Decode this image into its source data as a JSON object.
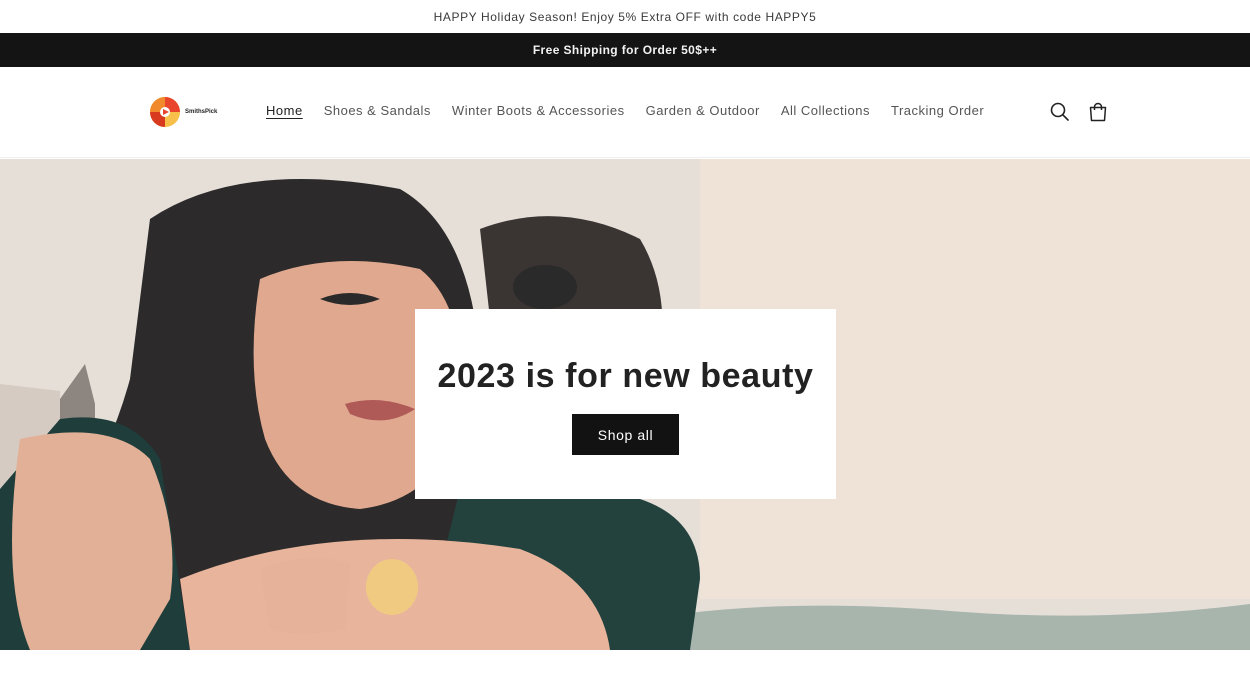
{
  "announcement": {
    "text": "HAPPY Holiday Season! Enjoy 5% Extra OFF with code HAPPY5"
  },
  "shipping_bar": {
    "text": "Free Shipping for Order 50$++"
  },
  "header": {
    "logo_text": "SmithsPick",
    "nav": [
      {
        "label": "Home",
        "active": true
      },
      {
        "label": "Shoes & Sandals"
      },
      {
        "label": "Winter Boots & Accessories"
      },
      {
        "label": "Garden & Outdoor"
      },
      {
        "label": "All Collections"
      },
      {
        "label": "Tracking Order"
      }
    ],
    "icons": {
      "search": "search-icon",
      "cart": "cart-icon"
    }
  },
  "hero": {
    "title": "2023 is for new beauty",
    "button_label": "Shop all"
  },
  "colors": {
    "shipping_bar_bg": "#141414",
    "button_bg": "#121212",
    "logo_accent": "#e8452c"
  }
}
